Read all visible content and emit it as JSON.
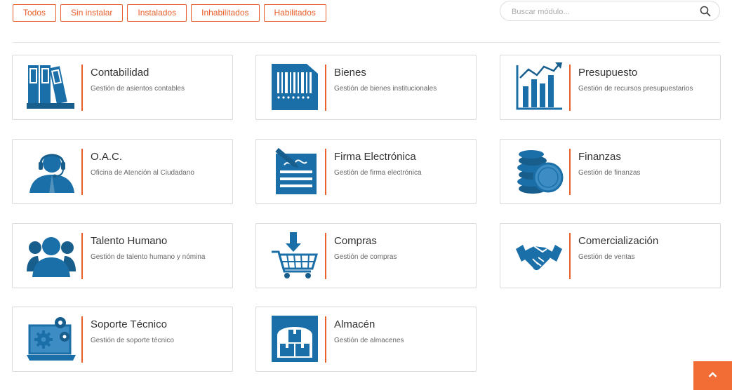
{
  "filters": [
    "Todos",
    "Sin instalar",
    "Instalados",
    "Inhabilitados",
    "Habilitados"
  ],
  "search": {
    "placeholder": "Buscar módulo..."
  },
  "modules": [
    {
      "title": "Contabilidad",
      "desc": "Gestión de asientos contables",
      "icon": "binders-icon"
    },
    {
      "title": "Bienes",
      "desc": "Gestión de bienes institucionales",
      "icon": "barcode-icon"
    },
    {
      "title": "Presupuesto",
      "desc": "Gestión de recursos presupuestarios",
      "icon": "bar-chart-icon"
    },
    {
      "title": "O.A.C.",
      "desc": "Oficina de Atención al Ciudadano",
      "icon": "headset-agent-icon"
    },
    {
      "title": "Firma Electrónica",
      "desc": "Gestión de firma electrónica",
      "icon": "signature-document-icon"
    },
    {
      "title": "Finanzas",
      "desc": "Gestión de finanzas",
      "icon": "coins-icon"
    },
    {
      "title": "Talento Humano",
      "desc": "Gestión de talento humano y nómina",
      "icon": "people-icon"
    },
    {
      "title": "Compras",
      "desc": "Gestión de compras",
      "icon": "shopping-cart-icon"
    },
    {
      "title": "Comercialización",
      "desc": "Gestión de ventas",
      "icon": "handshake-icon"
    },
    {
      "title": "Soporte Técnico",
      "desc": "Gestión de soporte técnico",
      "icon": "laptop-gears-icon"
    },
    {
      "title": "Almacén",
      "desc": "Gestión de almacenes",
      "icon": "warehouse-boxes-icon"
    }
  ],
  "colors": {
    "accent": "#e8612c",
    "icon": "#1b6fa8",
    "icon_dark": "#175e8c"
  }
}
